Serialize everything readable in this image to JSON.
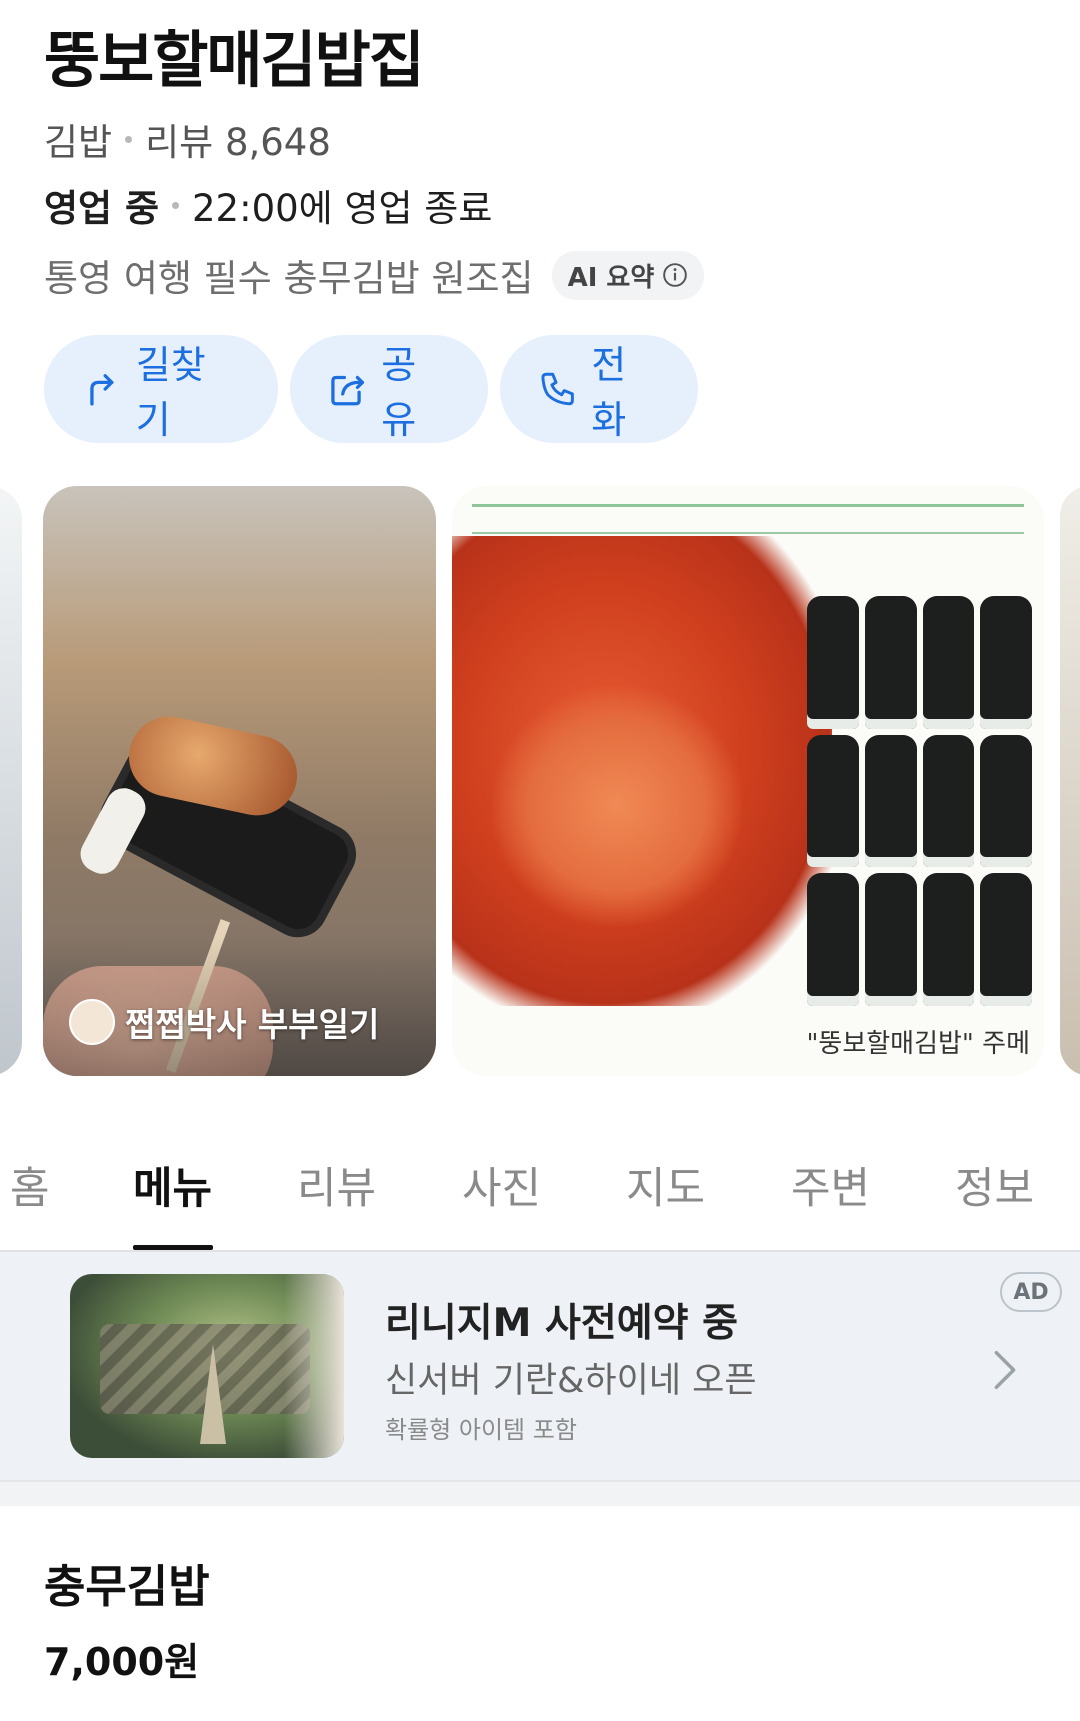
{
  "place": {
    "name": "뚱보할매김밥집",
    "category": "김밥",
    "review_label": "리뷰",
    "review_count": "8,648",
    "status": "영업 중",
    "hours_note": "22:00에 영업 종료",
    "summary": "통영 여행 필수 충무김밥 원조집",
    "ai_badge": "AI 요약"
  },
  "actions": [
    {
      "label": "길찾기",
      "icon": "route-arrow-icon"
    },
    {
      "label": "공유",
      "icon": "share-icon"
    },
    {
      "label": "전화",
      "icon": "phone-icon"
    }
  ],
  "photos": {
    "caption": "쩝쩝박사 부부일기",
    "photo2_label": "\"뚱보할매김밥\" 주메"
  },
  "tabs": [
    "홈",
    "메뉴",
    "리뷰",
    "사진",
    "지도",
    "주변",
    "정보"
  ],
  "active_tab": "메뉴",
  "ad": {
    "title": "리니지M 사전예약 중",
    "subtitle": "신서버 기란&하이네 오픈",
    "note": "확률형 아이템 포함",
    "badge": "AD"
  },
  "menu": [
    {
      "name": "충무김밥",
      "price": "7,000원"
    }
  ],
  "colors": {
    "accent": "#1d6fe0",
    "button_bg": "#e6f0fc",
    "ad_bg": "#eef2f6"
  }
}
